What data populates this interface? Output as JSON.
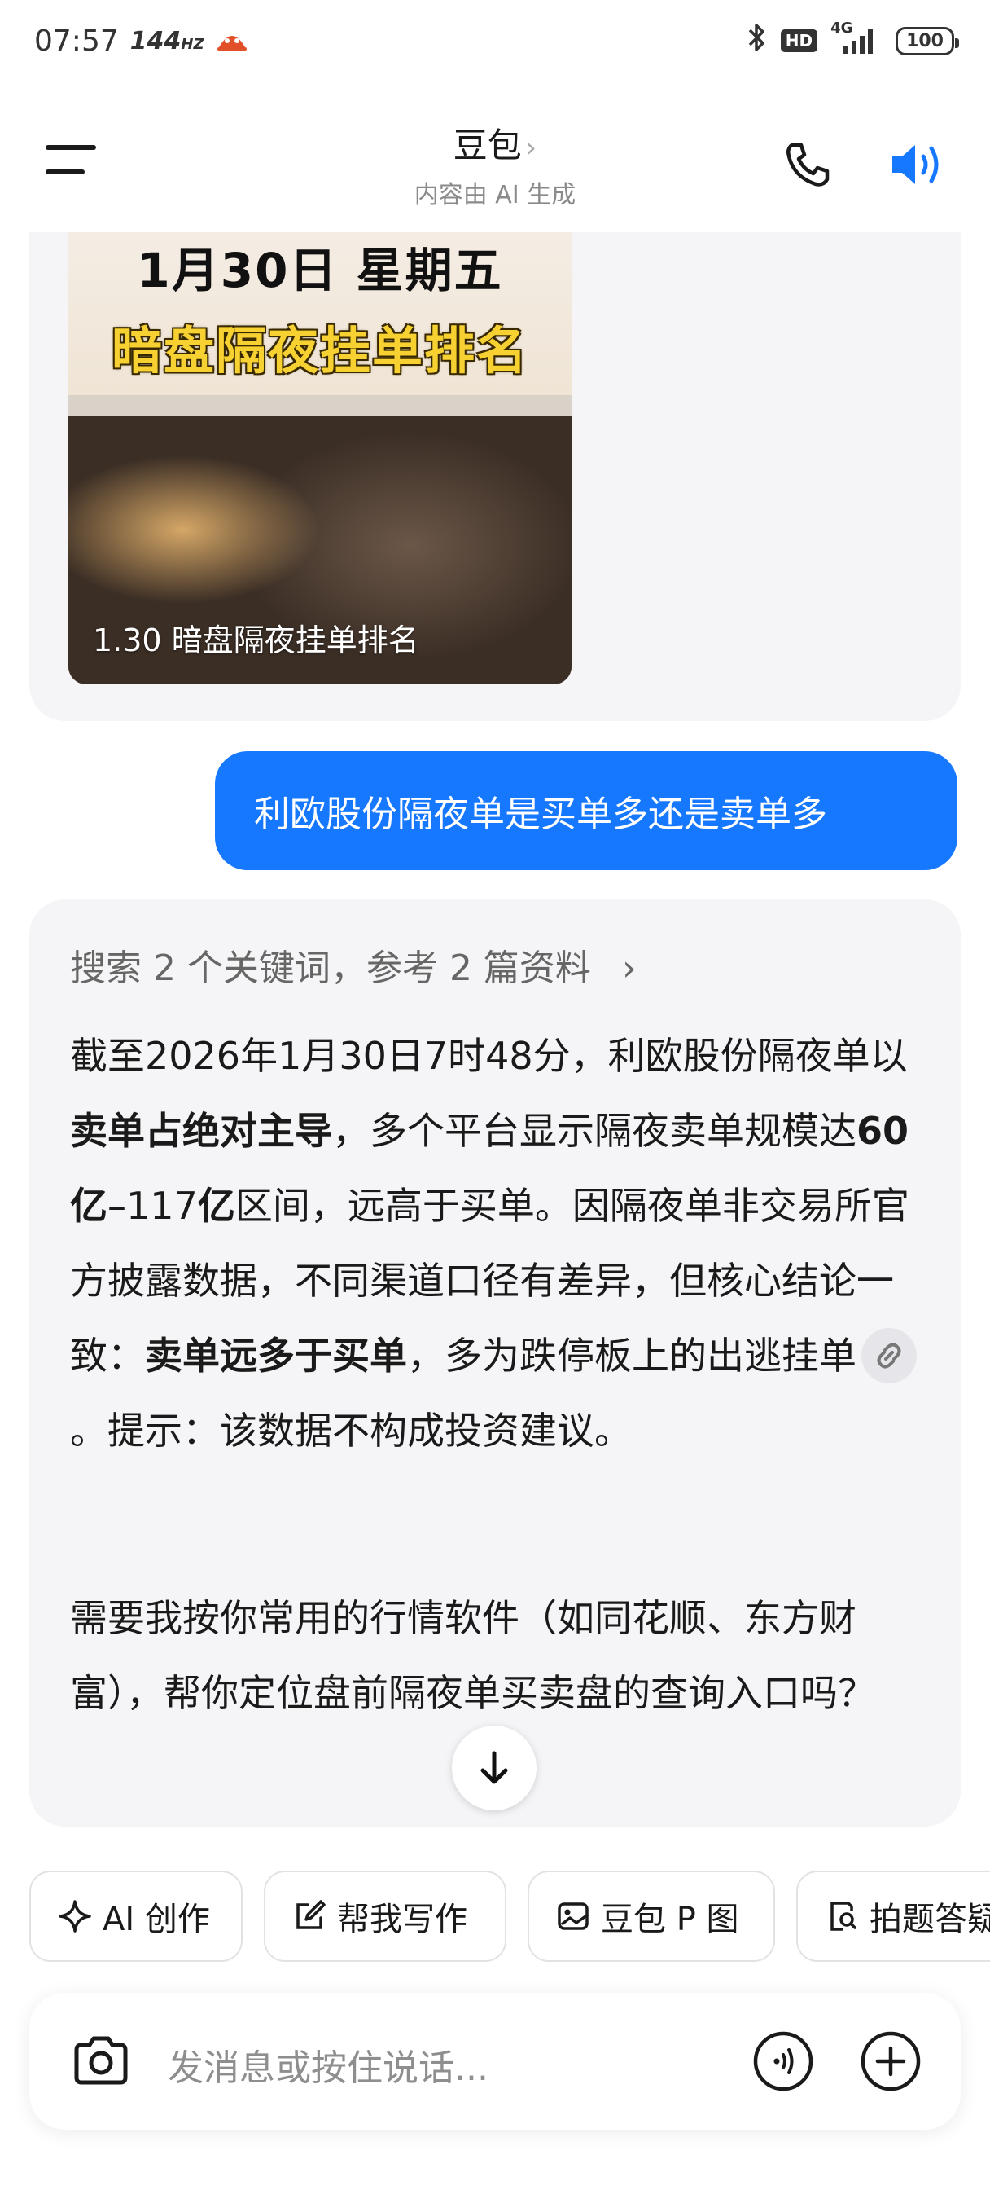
{
  "status_bar": {
    "time": "07:57",
    "refresh_rate": "144",
    "refresh_unit": "HZ",
    "hd_badge": "HD",
    "network": "4G",
    "battery": "100"
  },
  "header": {
    "title": "豆包",
    "subtitle": "内容由 AI 生成"
  },
  "shared_card": {
    "title_line1": "1月30日 星期五",
    "title_line2": "暗盘隔夜挂单排名",
    "caption": "1.30 暗盘隔夜挂单排名"
  },
  "user_message": "利欧股份隔夜单是买单多还是卖单多",
  "ai_message": {
    "search_ref": "搜索 2 个关键词，参考 2 篇资料",
    "p1_a": "截至2026年1月30日7时48分，利欧股份隔夜单以",
    "p1_b": "卖单占绝对主导",
    "p1_c": "，多个平台显示隔夜卖单规模达",
    "p1_d": "60亿",
    "p1_e": "–117",
    "p1_f": "亿",
    "p1_g": "区间，远高于买单。因隔夜单非交易所官方披露数据，不同渠道口径有差异，但核心结论一致：",
    "p1_h": "卖单远多于买单",
    "p1_i": "，多为跌停板上的出逃挂单",
    "p1_j": "。提示：该数据不构成投资建议。",
    "p2": "需要我按你常用的行情软件（如同花顺、东方财富），帮你定位盘前隔夜单买卖盘的查询入口吗？"
  },
  "quick_actions": [
    {
      "label": "AI 创作",
      "icon": "sparkle-icon"
    },
    {
      "label": "帮我写作",
      "icon": "edit-icon"
    },
    {
      "label": "豆包 P 图",
      "icon": "image-edit-icon"
    },
    {
      "label": "拍题答疑",
      "icon": "search-doc-icon"
    }
  ],
  "input": {
    "placeholder": "发消息或按住说话..."
  },
  "colors": {
    "accent": "#1677ff",
    "bubble_bg": "#f5f5f7"
  }
}
